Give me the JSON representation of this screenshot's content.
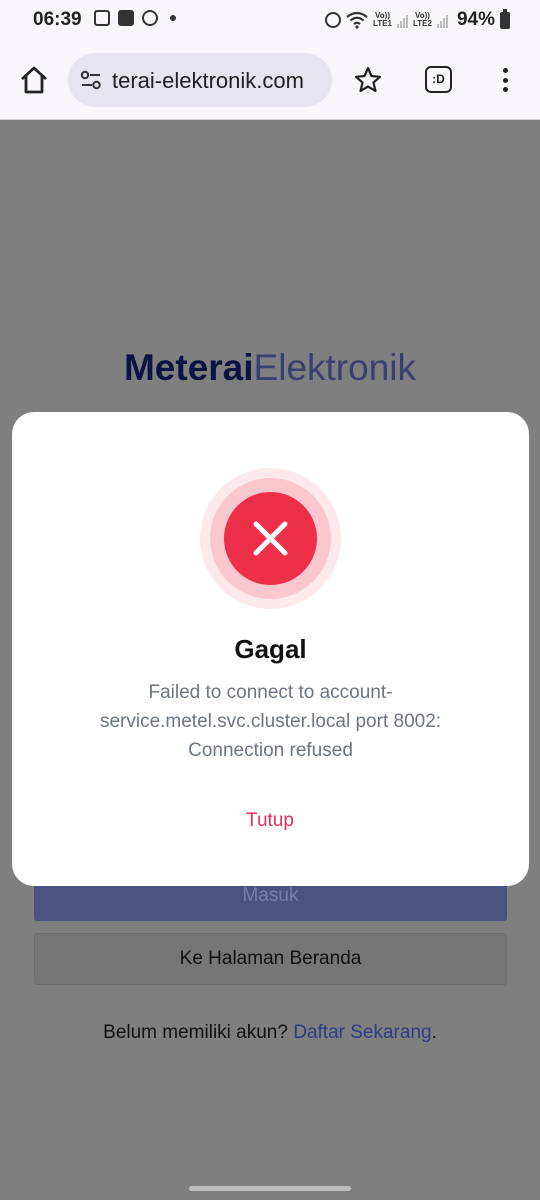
{
  "status_bar": {
    "time": "06:39",
    "lte1": "LTE1",
    "lte2": "LTE2",
    "vo": "Vo))",
    "battery": "94%"
  },
  "browser": {
    "url": "terai-elektronik.com",
    "tab_label": ":D"
  },
  "page": {
    "logo_bold": "Meterai",
    "logo_light": "Elektronik",
    "login_button": "Masuk",
    "home_button": "Ke Halaman Beranda",
    "signup_prefix": "Belum memiliki akun? ",
    "signup_link": "Daftar Sekarang",
    "signup_suffix": "."
  },
  "modal": {
    "title": "Gagal",
    "message": "Failed to connect to account-service.metel.svc.cluster.local port 8002: Connection refused",
    "close_button": "Tutup",
    "error_color": "#ee2f49"
  }
}
